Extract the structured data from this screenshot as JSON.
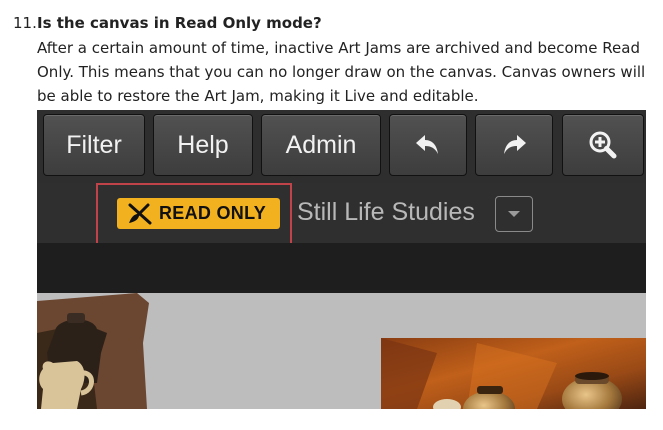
{
  "faq": {
    "number": "11.",
    "question": "Is the canvas in Read Only mode?",
    "answer": "After a certain amount of time, inactive Art Jams are archived and become Read Only. This means that you can no longer draw on the canvas. Canvas owners will be able to restore the Art Jam, making it Live and editable."
  },
  "screenshot": {
    "toolbar": {
      "filter_label": "Filter",
      "help_label": "Help",
      "admin_label": "Admin",
      "undo_icon": "undo-icon",
      "redo_icon": "redo-icon",
      "zoom_icon": "zoom-in-icon"
    },
    "status_badge": {
      "label": "READ ONLY",
      "icon": "no-brush-icon",
      "color": "#f2b11f"
    },
    "art_jam_title": "Still Life Studies",
    "dropdown_icon": "chevron-down-icon",
    "highlight_color": "#c0434a"
  }
}
